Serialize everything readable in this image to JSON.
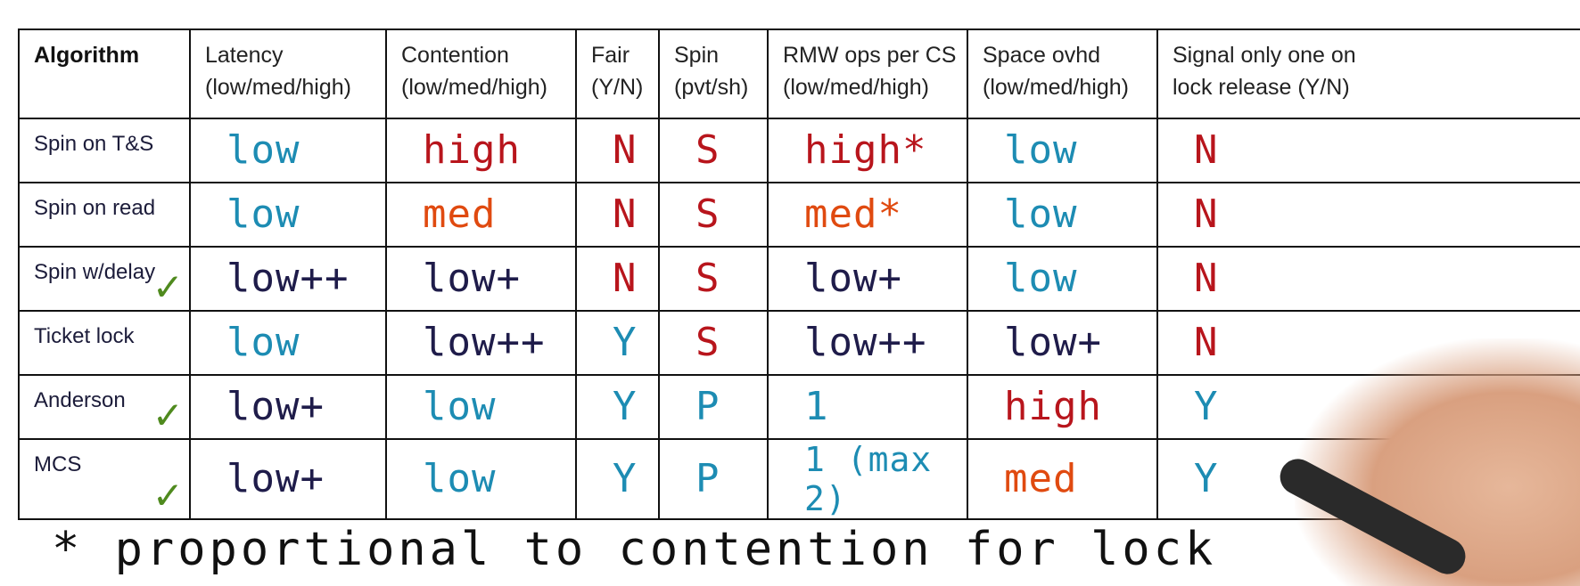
{
  "table": {
    "headers": [
      {
        "line1": "Algorithm",
        "line2": ""
      },
      {
        "line1": "Latency",
        "line2": "(low/med/high)"
      },
      {
        "line1": "Contention",
        "line2": "(low/med/high)"
      },
      {
        "line1": "Fair",
        "line2": "(Y/N)"
      },
      {
        "line1": "Spin",
        "line2": "(pvt/sh)"
      },
      {
        "line1": "RMW ops per CS",
        "line2": "(low/med/high)"
      },
      {
        "line1": "Space ovhd",
        "line2": "(low/med/high)"
      },
      {
        "line1": "Signal only one on",
        "line2": "lock release (Y/N)"
      }
    ],
    "rows": [
      {
        "name": "Spin on T&S",
        "check": "",
        "cells": [
          {
            "text": "low",
            "color": "#1d8cb3"
          },
          {
            "text": "high",
            "color": "#b8151c"
          },
          {
            "text": "N",
            "color": "#b8151c"
          },
          {
            "text": "S",
            "color": "#b8151c"
          },
          {
            "text": "high*",
            "color": "#b8151c"
          },
          {
            "text": "low",
            "color": "#1d8cb3"
          },
          {
            "text": "N",
            "color": "#b8151c"
          }
        ]
      },
      {
        "name": "Spin on read",
        "check": "",
        "cells": [
          {
            "text": "low",
            "color": "#1d8cb3"
          },
          {
            "text": "med",
            "color": "#e04a10"
          },
          {
            "text": "N",
            "color": "#b8151c"
          },
          {
            "text": "S",
            "color": "#b8151c"
          },
          {
            "text": "med*",
            "color": "#e04a10"
          },
          {
            "text": "low",
            "color": "#1d8cb3"
          },
          {
            "text": "N",
            "color": "#b8151c"
          }
        ]
      },
      {
        "name": "Spin w/delay",
        "check": "✓",
        "cells": [
          {
            "text": "low++",
            "color": "#1f1c4a"
          },
          {
            "text": "low+",
            "color": "#1f1c4a"
          },
          {
            "text": "N",
            "color": "#b8151c"
          },
          {
            "text": "S",
            "color": "#b8151c"
          },
          {
            "text": "low+",
            "color": "#1f1c4a"
          },
          {
            "text": "low",
            "color": "#1d8cb3"
          },
          {
            "text": "N",
            "color": "#b8151c"
          }
        ]
      },
      {
        "name": "Ticket lock",
        "check": "",
        "cells": [
          {
            "text": "low",
            "color": "#1d8cb3"
          },
          {
            "text": "low++",
            "color": "#1f1c4a"
          },
          {
            "text": "Y",
            "color": "#1d8cb3"
          },
          {
            "text": "S",
            "color": "#b8151c"
          },
          {
            "text": "low++",
            "color": "#1f1c4a"
          },
          {
            "text": "low+",
            "color": "#1f1c4a"
          },
          {
            "text": "N",
            "color": "#b8151c"
          }
        ]
      },
      {
        "name": "Anderson",
        "check": "✓",
        "cells": [
          {
            "text": "low+",
            "color": "#1f1c4a"
          },
          {
            "text": "low",
            "color": "#1d8cb3"
          },
          {
            "text": "Y",
            "color": "#1d8cb3"
          },
          {
            "text": "P",
            "color": "#1d8cb3"
          },
          {
            "text": "1",
            "color": "#1d8cb3"
          },
          {
            "text": "high",
            "color": "#b8151c"
          },
          {
            "text": "Y",
            "color": "#1d8cb3"
          }
        ]
      },
      {
        "name": "MCS",
        "check": "✓",
        "cells": [
          {
            "text": "low+",
            "color": "#1f1c4a"
          },
          {
            "text": "low",
            "color": "#1d8cb3"
          },
          {
            "text": "Y",
            "color": "#1d8cb3"
          },
          {
            "text": "P",
            "color": "#1d8cb3"
          },
          {
            "text": "1 (max 2)",
            "color": "#1d8cb3"
          },
          {
            "text": "med",
            "color": "#e04a10"
          },
          {
            "text": "Y",
            "color": "#1d8cb3"
          }
        ]
      }
    ]
  },
  "footnote": "* proportional to contention for lock",
  "icons": {
    "check": "checkmark-icon"
  }
}
